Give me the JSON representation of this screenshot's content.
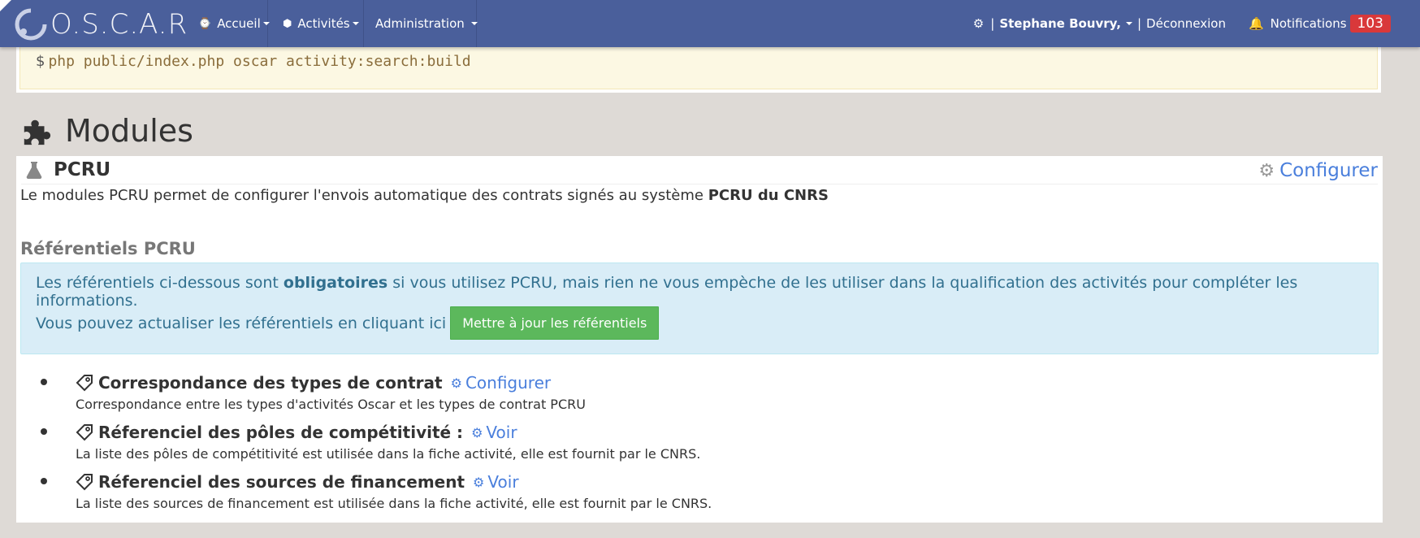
{
  "navbar": {
    "brand": "O.S.C.A.R",
    "menu": [
      {
        "label": "Accueil",
        "icon": "watch-icon"
      },
      {
        "label": "Activités",
        "icon": "cube-icon"
      },
      {
        "label": "Administration"
      }
    ],
    "user_name": "Stephane Bouvry,",
    "pipe": "|",
    "logout": "Déconnexion",
    "notifications_label": "Notifications",
    "notifications_count": "103"
  },
  "command": {
    "prompt": "$",
    "text": "php public/index.php oscar activity:search:build"
  },
  "page": {
    "title": "Modules"
  },
  "module": {
    "name": "PCRU",
    "configure": "Configurer",
    "description_prefix": "Le modules PCRU permet de configurer l'envois automatique des contrats signés au système ",
    "description_bold": "PCRU du CNRS",
    "referentiels_title": "Référentiels PCRU",
    "info_prefix": "Les référentiels ci-dessous sont ",
    "info_bold": "obligatoires",
    "info_suffix": " si vous utilisez PCRU, mais rien ne vous empèche de les utiliser dans la qualification des activités pour compléter les informations.",
    "update_text": "Vous pouvez actualiser les référentiels en cliquant ici",
    "update_button": "Mettre à jour les référentiels",
    "items": [
      {
        "title": "Correspondance des types de contrat",
        "link": "Configurer",
        "description": "Correspondance entre les types d'activités Oscar et les types de contrat PCRU"
      },
      {
        "title": "Réferenciel des pôles de compétitivité :",
        "link": "Voir",
        "description": "La liste des pôles de compétitivité est utilisée dans la fiche activité, elle est fournit par le CNRS."
      },
      {
        "title": "Réferenciel des sources de financement",
        "link": "Voir",
        "description": "La liste des sources de financement est utilisée dans la fiche activité, elle est fournit par le CNRS."
      }
    ]
  },
  "colors": {
    "navbar": "#4a5f9b",
    "link": "#4a7fdc",
    "info_bg": "#d9edf7",
    "button": "#5cb85c",
    "badge": "#d9383a"
  }
}
